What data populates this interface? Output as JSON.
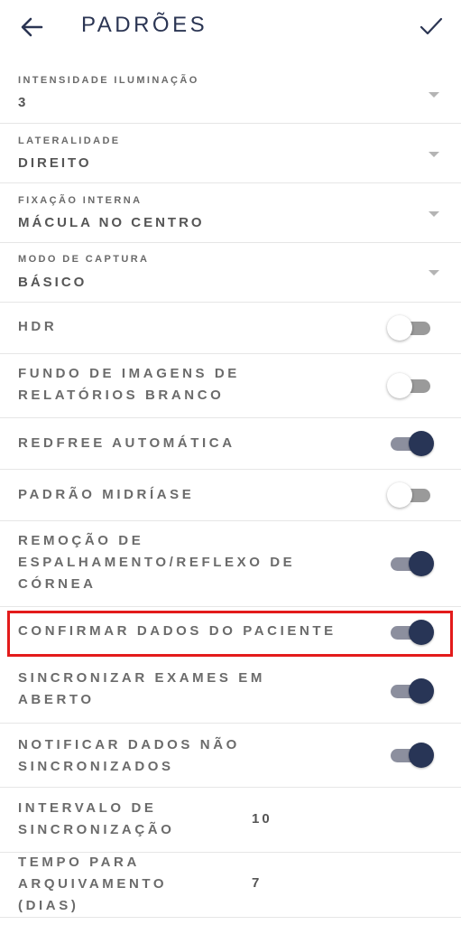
{
  "header": {
    "title": "PADRÕES",
    "back_icon": "arrow-left-icon",
    "confirm_icon": "checkmark-icon"
  },
  "selects": [
    {
      "label": "INTENSIDADE ILUMINAÇÃO",
      "value": "3"
    },
    {
      "label": "LATERALIDADE",
      "value": "DIREITO"
    },
    {
      "label": "FIXAÇÃO INTERNA",
      "value": "MÁCULA NO CENTRO"
    },
    {
      "label": "MODO DE CAPTURA",
      "value": "BÁSICO"
    }
  ],
  "toggles": [
    {
      "lines": [
        "HDR"
      ],
      "on": false
    },
    {
      "lines": [
        "FUNDO DE IMAGENS DE",
        "RELATÓRIOS BRANCO"
      ],
      "on": false
    },
    {
      "lines": [
        "REDFREE AUTOMÁTICA"
      ],
      "on": true
    },
    {
      "lines": [
        "PADRÃO MIDRÍASE"
      ],
      "on": false
    },
    {
      "lines": [
        "REMOÇÃO DE",
        "ESPALHAMENTO/REFLEXO DE",
        "CÓRNEA"
      ],
      "on": true
    },
    {
      "lines": [
        "CONFIRMAR DADOS DO PACIENTE"
      ],
      "on": true
    },
    {
      "lines": [
        "SINCRONIZAR EXAMES EM",
        "ABERTO"
      ],
      "on": true
    },
    {
      "lines": [
        "NOTIFICAR DADOS NÃO",
        "SINCRONIZADOS"
      ],
      "on": true
    }
  ],
  "numbers": [
    {
      "lines": [
        "INTERVALO DE",
        "SINCRONIZAÇÃO"
      ],
      "value": "10"
    },
    {
      "lines": [
        "TEMPO PARA",
        "ARQUIVAMENTO",
        "(DIAS)"
      ],
      "value": "7"
    }
  ],
  "colors": {
    "accent": "#283556",
    "highlight": "#e31b1b"
  }
}
